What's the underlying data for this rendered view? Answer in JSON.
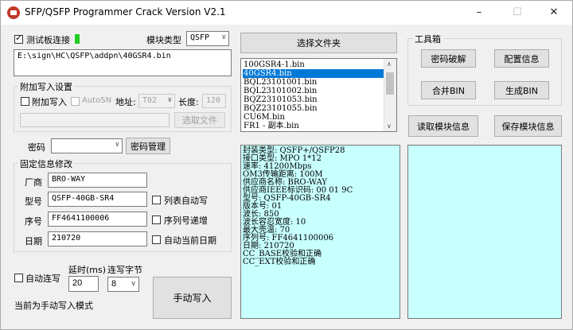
{
  "window": {
    "title": "SFP/QSFP Programmer Crack Version V2.1",
    "minimize": "–",
    "maximize": "☐",
    "close": "✕"
  },
  "top": {
    "test_board_label": "测试板连接",
    "test_board_checked": true,
    "module_type_label": "模块类型",
    "module_type_value": "QSFP",
    "file_path": "E:\\sign\\HC\\QSFP\\addpn\\40GSR4.bin",
    "select_folder_button": "选择文件夹"
  },
  "attach": {
    "group_title": "附加写入设置",
    "attach_write_label": "附加写入",
    "autosn_label": "AutoSN",
    "address_label": "地址:",
    "address_value": "T02",
    "length_label": "长度:",
    "length_value": "120",
    "select_file_button": "选取文件"
  },
  "password": {
    "label": "密码",
    "manage_button": "密码管理"
  },
  "fixed": {
    "group_title": "固定信息修改",
    "vendor_label": "厂商",
    "vendor_value": "BRO-WAY",
    "model_label": "型号",
    "model_value": "QSFP-40GB-SR4",
    "serial_label": "序号",
    "serial_value": "FF4641100006",
    "date_label": "日期",
    "date_value": "210720",
    "list_auto_write": "列表自动写",
    "serial_increment": "序列号递增",
    "auto_date": "自动当前日期"
  },
  "bottom": {
    "auto_write_label": "自动连写",
    "delay_label": "延时(ms)",
    "delay_value": "20",
    "bytes_label": "连写字节",
    "bytes_value": "8",
    "manual_write_button": "手动写入",
    "status": "当前为手动写入模式"
  },
  "file_list": {
    "items": [
      "100GSR4-1.bin",
      "40GSR4.bin",
      "BQL23101001.bin",
      "BQL23101002.bin",
      "BQZ23101053.bin",
      "BQZ23101055.bin",
      "CU6M.bin",
      "FR1 - 副本.bin"
    ],
    "selected_index": 1
  },
  "toolbox": {
    "group_title": "工具箱",
    "crack_password": "密码破解",
    "config_info": "配置信息",
    "merge_bin": "合并BIN",
    "generate_bin": "生成BIN",
    "read_module": "读取模块信息",
    "save_module": "保存模块信息"
  },
  "module_info": {
    "lines": [
      "封装类型: QSFP+/QSFP28",
      "接口类型: MPO 1*12",
      "速率: 41200Mbps",
      "OM3传输距离: 100M",
      "供应商名称: BRO-WAY",
      "供应商IEEE标识码: 00 01 9C",
      "型号: QSFP-40GB-SR4",
      "版本号: 01",
      "波长: 850",
      "波长容忍宽度: 10",
      "最大壳温: 70",
      "序列号: FF4641100006",
      "日期: 210720",
      "CC_BASE校验和正确",
      "CC_EXT校验和正确"
    ]
  }
}
